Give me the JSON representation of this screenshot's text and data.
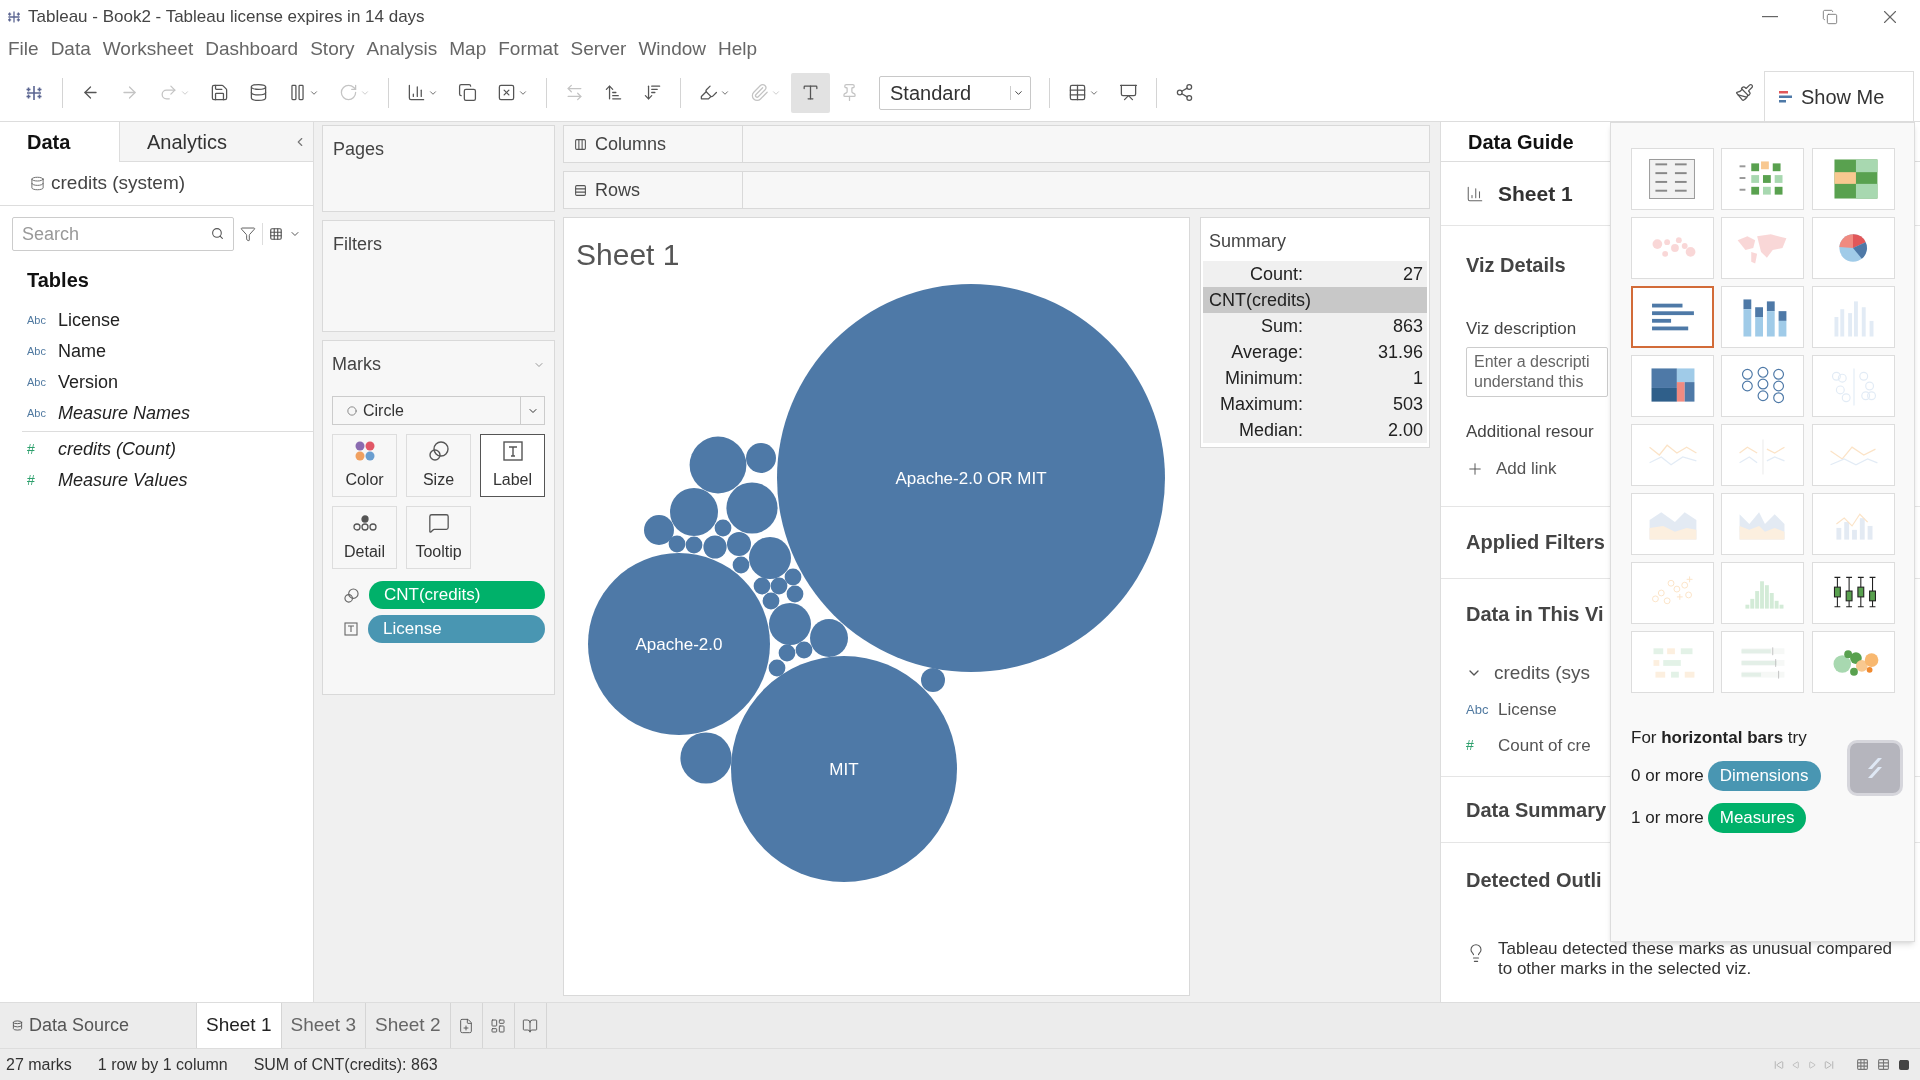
{
  "window": {
    "title": "Tableau - Book2 - Tableau license expires in 14 days"
  },
  "menu": [
    "File",
    "Data",
    "Worksheet",
    "Dashboard",
    "Story",
    "Analysis",
    "Map",
    "Format",
    "Server",
    "Window",
    "Help"
  ],
  "toolbar": {
    "groups": [
      [
        {
          "kind": "back",
          "disabled": false,
          "on": false,
          "menu": false
        },
        {
          "kind": "forward",
          "disabled": true,
          "on": false,
          "menu": false
        },
        {
          "kind": "replay",
          "disabled": true,
          "on": false,
          "menu": true
        },
        {
          "kind": "save",
          "disabled": false,
          "on": false,
          "menu": false
        },
        {
          "kind": "new-data-source",
          "disabled": false,
          "on": false,
          "menu": false
        },
        {
          "kind": "pause",
          "disabled": false,
          "on": false,
          "menu": true
        },
        {
          "kind": "refresh",
          "disabled": true,
          "on": false,
          "menu": true
        }
      ],
      [
        {
          "kind": "new-sheet",
          "disabled": false,
          "on": false,
          "menu": true
        },
        {
          "kind": "duplicate",
          "disabled": false,
          "on": false,
          "menu": false
        },
        {
          "kind": "clear",
          "disabled": false,
          "on": false,
          "menu": true
        }
      ],
      [
        {
          "kind": "swap",
          "disabled": true,
          "on": false,
          "menu": false
        },
        {
          "kind": "sort-ascending",
          "disabled": false,
          "on": false,
          "menu": false
        },
        {
          "kind": "sort-descending",
          "disabled": false,
          "on": false,
          "menu": false
        }
      ],
      [
        {
          "kind": "highlight",
          "disabled": false,
          "on": false,
          "menu": true
        },
        {
          "kind": "group",
          "disabled": true,
          "on": false,
          "menu": true
        },
        {
          "kind": "labels",
          "disabled": false,
          "on": true,
          "menu": false
        },
        {
          "kind": "pin",
          "disabled": true,
          "on": false,
          "menu": false
        },
        {
          "kind": "fit",
          "disabled": false,
          "on": false,
          "menu": true,
          "value": "Standard"
        }
      ],
      [
        {
          "kind": "cards",
          "disabled": false,
          "on": false,
          "menu": true
        },
        {
          "kind": "presentation",
          "disabled": false,
          "on": false,
          "menu": false
        }
      ],
      [
        {
          "kind": "share",
          "disabled": false,
          "on": false,
          "menu": false
        }
      ]
    ],
    "show_me_label": "Show Me"
  },
  "data_pane": {
    "tabs": [
      {
        "label": "Data",
        "selected": true
      },
      {
        "label": "Analytics",
        "selected": false
      }
    ],
    "source": "credits (system)",
    "search": {
      "placeholder": "Search"
    },
    "tables_heading": "Tables",
    "fields": [
      {
        "name": "License",
        "kind": "dimension",
        "generated": false,
        "type_label": "Abc"
      },
      {
        "name": "Name",
        "kind": "dimension",
        "generated": false,
        "type_label": "Abc"
      },
      {
        "name": "Version",
        "kind": "dimension",
        "generated": false,
        "type_label": "Abc"
      },
      {
        "name": "Measure Names",
        "kind": "dimension",
        "generated": true,
        "type_label": "Abc"
      },
      {
        "name": "credits (Count)",
        "kind": "measure",
        "generated": true,
        "type_label": "#"
      },
      {
        "name": "Measure Values",
        "kind": "measure",
        "generated": true,
        "type_label": "#"
      }
    ]
  },
  "cards": {
    "pages": "Pages",
    "filters": "Filters",
    "marks": {
      "title": "Marks",
      "mark_type": "Circle",
      "buttons": [
        {
          "label": "Color",
          "kind": "color",
          "selected": false
        },
        {
          "label": "Size",
          "kind": "size",
          "selected": false
        },
        {
          "label": "Label",
          "kind": "label",
          "selected": true
        },
        {
          "label": "Detail",
          "kind": "detail",
          "selected": false
        },
        {
          "label": "Tooltip",
          "kind": "tooltip",
          "selected": false
        }
      ],
      "pills": [
        {
          "label": "CNT(credits)",
          "kind": "size",
          "color": "#00b16a"
        },
        {
          "label": "License",
          "kind": "label",
          "color": "#4996b2"
        }
      ]
    }
  },
  "shelves": {
    "columns": "Columns",
    "rows": "Rows"
  },
  "viz": {
    "title": "Sheet 1",
    "bubble_labels": [
      "Apache-2.0 OR MIT",
      "Apache-2.0",
      "MIT"
    ]
  },
  "summary": {
    "title": "Summary",
    "rows": [
      {
        "kind": "stat",
        "label": "Count:",
        "value": "27"
      },
      {
        "kind": "header",
        "label": "CNT(credits)"
      },
      {
        "kind": "stat",
        "label": "Sum:",
        "value": "863"
      },
      {
        "kind": "stat",
        "label": "Average:",
        "value": "31.96"
      },
      {
        "kind": "stat",
        "label": "Minimum:",
        "value": "1"
      },
      {
        "kind": "stat",
        "label": "Maximum:",
        "value": "503"
      },
      {
        "kind": "stat",
        "label": "Median:",
        "value": "2.00"
      }
    ]
  },
  "data_guide": {
    "title": "Data Guide",
    "sheet": "Sheet 1",
    "viz_details": "Viz Details",
    "description_label": "Viz description",
    "description_placeholder": [
      "Enter a descripti",
      "understand this"
    ],
    "resources_label": "Additional resour",
    "add_link": "Add link",
    "applied_filters": "Applied Filters",
    "data_in_viz": "Data in This Vi",
    "source": {
      "label": "credits (sys",
      "expanded": true,
      "children": [
        {
          "name": "License",
          "kind": "dimension",
          "type_label": "Abc"
        },
        {
          "name": "Count of cre",
          "kind": "measure",
          "type_label": "#"
        }
      ]
    },
    "data_summary": "Data Summary",
    "outliers": "Detected Outli",
    "outliers_text": "Tableau detected these marks as unusual compared to other marks in the selected viz."
  },
  "show_me": {
    "charts": [
      {
        "kind": "text-table",
        "enabled": true,
        "selected": false
      },
      {
        "kind": "heat-map",
        "enabled": true,
        "selected": false
      },
      {
        "kind": "highlight-table",
        "enabled": true,
        "selected": false
      },
      {
        "kind": "symbol-map",
        "enabled": false,
        "selected": false
      },
      {
        "kind": "filled-map",
        "enabled": false,
        "selected": false
      },
      {
        "kind": "pie",
        "enabled": true,
        "selected": false
      },
      {
        "kind": "horizontal-bars",
        "enabled": true,
        "selected": true
      },
      {
        "kind": "stacked-bars",
        "enabled": true,
        "selected": false
      },
      {
        "kind": "side-by-side-bars",
        "enabled": false,
        "selected": false
      },
      {
        "kind": "treemap",
        "enabled": true,
        "selected": false
      },
      {
        "kind": "circle-views",
        "enabled": true,
        "selected": false
      },
      {
        "kind": "side-by-side-circles",
        "enabled": false,
        "selected": false
      },
      {
        "kind": "lines-continuous",
        "enabled": false,
        "selected": false
      },
      {
        "kind": "lines-discrete",
        "enabled": false,
        "selected": false
      },
      {
        "kind": "dual-lines",
        "enabled": false,
        "selected": false
      },
      {
        "kind": "area-continuous",
        "enabled": false,
        "selected": false
      },
      {
        "kind": "area-discrete",
        "enabled": false,
        "selected": false
      },
      {
        "kind": "dual-combination",
        "enabled": false,
        "selected": false
      },
      {
        "kind": "scatter",
        "enabled": false,
        "selected": false
      },
      {
        "kind": "histogram",
        "enabled": false,
        "selected": false
      },
      {
        "kind": "box-plot",
        "enabled": true,
        "selected": false
      },
      {
        "kind": "gantt",
        "enabled": false,
        "selected": false
      },
      {
        "kind": "bullet",
        "enabled": false,
        "selected": false
      },
      {
        "kind": "packed-bubbles",
        "enabled": true,
        "selected": false
      }
    ],
    "hint": "For **horizontal bars** try",
    "requirements": [
      {
        "text": "0 or more",
        "pill": "Dimensions",
        "color": "#4996b2"
      },
      {
        "text": "1 or more",
        "pill": "Measures",
        "color": "#00b16a"
      }
    ]
  },
  "sheet_tabs": {
    "data_source": "Data Source",
    "sheets": [
      {
        "label": "Sheet 1",
        "selected": true
      },
      {
        "label": "Sheet 3",
        "selected": false
      },
      {
        "label": "Sheet 2",
        "selected": false
      }
    ]
  },
  "status_bar": [
    "27 marks",
    "1 row by 1 column",
    "SUM of CNT(credits): 863"
  ]
}
